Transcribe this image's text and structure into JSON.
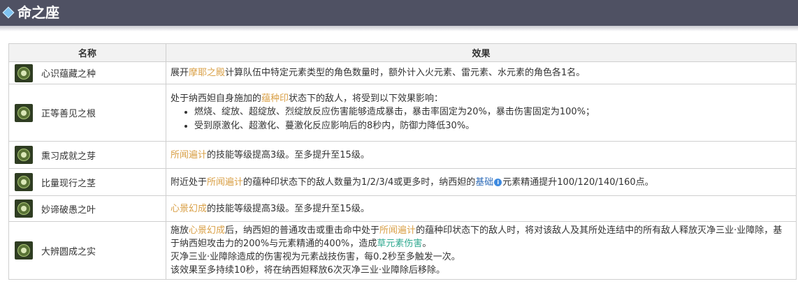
{
  "header": {
    "title": "命之座"
  },
  "table": {
    "col_name": "名称",
    "col_effect": "效果",
    "rows": [
      {
        "name": "心识蕴藏之种",
        "e_pre": "展开",
        "e_hl": "摩耶之殿",
        "e_post": "计算队伍中特定元素类型的角色数量时，额外计入火元素、雷元素、水元素的角色各1名。"
      },
      {
        "name": "正等善见之根",
        "e_pre": "处于纳西妲自身施加的",
        "e_hl": "蕴种印",
        "e_post": "状态下的敌人，将受到以下效果影响：",
        "bullets": [
          "燃烧、绽放、超绽放、烈绽放反应伤害能够造成暴击，暴击率固定为20%，暴击伤害固定为100%；",
          "受到原激化、超激化、蔓激化反应影响后的8秒内，防御力降低30%。"
        ]
      },
      {
        "name": "熏习成就之芽",
        "e_hl": "所闻遍计",
        "e_post": "的技能等级提高3级。至多提升至15级。"
      },
      {
        "name": "比量现行之茎",
        "e_pre": "附近处于",
        "e_hl": "所闻遍计",
        "e_mid": "的蕴种印状态下的敌人数量为1/2/3/4或更多时，纳西妲的",
        "e_link": "基础",
        "e_icon": "i",
        "e_post": "元素精通提升100/120/140/160点。"
      },
      {
        "name": "妙谛破愚之叶",
        "e_hl": "心景幻成",
        "e_post": "的技能等级提高3级。至多提升至15级。"
      },
      {
        "name": "大辨圆成之实",
        "p1_a": "施放",
        "p1_hl1": "心景幻成",
        "p1_b": "后，纳西妲的普通攻击或重击命中处于",
        "p1_hl2": "所闻遍计",
        "p1_c": "的蕴种印状态下的敌人时，将对该敌人及其所处连结中的所有敌人释放灭净三业·业障除，基于纳西妲攻击力的200%与元素精通的400%，造成",
        "p1_hlg": "草元素伤害",
        "p1_d": "。",
        "p2": "灭净三业·业障除造成的伤害视为元素战技伤害，每0.2秒至多触发一次。",
        "p3": "该效果至多持续10秒，将在纳西妲释放6次灭净三业·业障除后移除。"
      }
    ]
  }
}
